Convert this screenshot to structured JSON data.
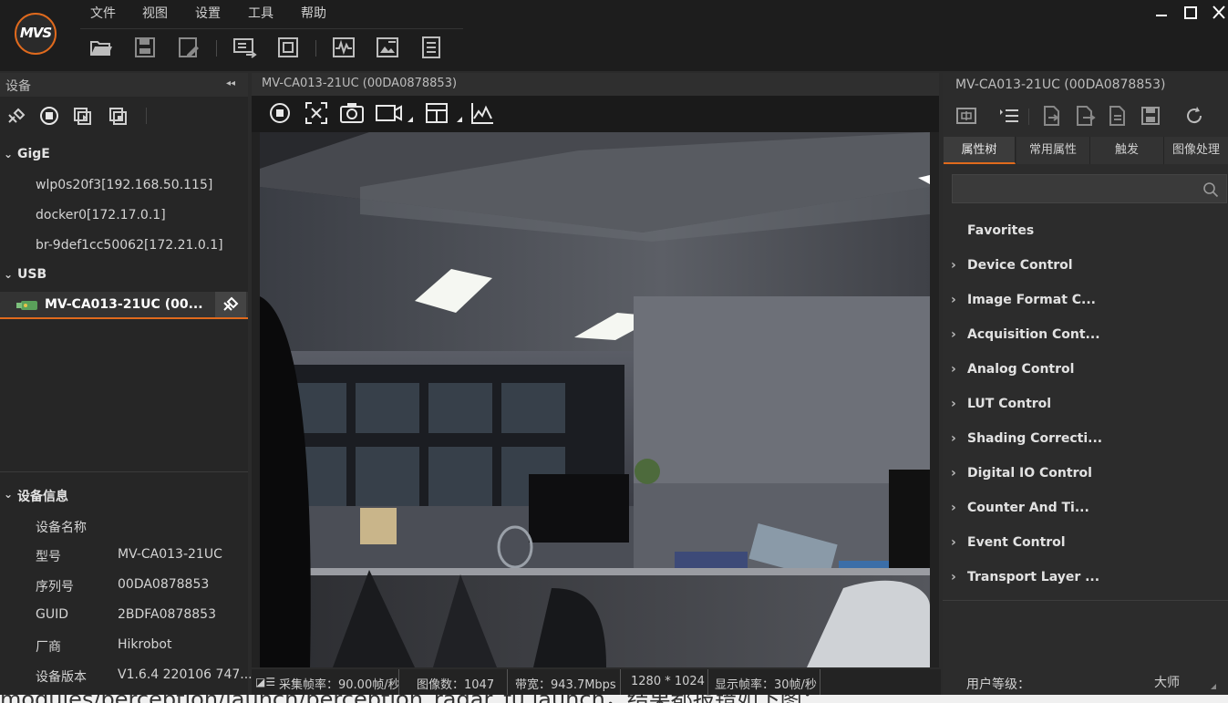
{
  "app": {
    "logo_text": "MVS"
  },
  "menu": [
    "文件",
    "视图",
    "设置",
    "工具",
    "帮助"
  ],
  "toolbar_icons": [
    "open-file-icon",
    "save-icon",
    "save-as-icon",
    "switch-layout-icon",
    "fullscreen-icon",
    "waveform-icon",
    "image-edit-icon",
    "log-icon"
  ],
  "window_controls": [
    "minimize-icon",
    "maximize-icon",
    "close-icon"
  ],
  "left_panel": {
    "title": "设备",
    "collapse": "◂◂",
    "groups": [
      {
        "label": "GigE",
        "items": [
          "wlp0s20f3[192.168.50.115]",
          "docker0[172.17.0.1]",
          "br-9def1cc50062[172.21.0.1]"
        ]
      },
      {
        "label": "USB"
      }
    ],
    "usb_device": "MV-CA013-21UC (00...",
    "device_info": {
      "title": "设备信息",
      "rows": [
        {
          "key": "设备名称",
          "value": ""
        },
        {
          "key": "型号",
          "value": "MV-CA013-21UC"
        },
        {
          "key": "序列号",
          "value": "00DA0878853"
        },
        {
          "key": "GUID",
          "value": "2BDFA0878853"
        },
        {
          "key": "厂商",
          "value": "Hikrobot"
        },
        {
          "key": "设备版本",
          "value": "V1.6.4 220106 747..."
        }
      ]
    }
  },
  "center": {
    "title": "MV-CA013-21UC (00DA0878853)",
    "status": {
      "fps": "采集帧率：90.00帧/秒",
      "frames": "图像数：1047",
      "bandwidth": "带宽：943.7Mbps",
      "resolution": "1280 * 1024",
      "display_fps": "显示帧率：30帧/秒"
    }
  },
  "right_panel": {
    "title": "MV-CA013-21UC (00DA0878853)",
    "tabs": [
      "属性树",
      "常用属性",
      "触发",
      "图像处理"
    ],
    "search_placeholder": "",
    "favorites": "Favorites",
    "properties": [
      "Device Control",
      "Image Format C...",
      "Acquisition Cont...",
      "Analog Control",
      "LUT Control",
      "Shading Correcti...",
      "Digital IO Control",
      "Counter And Ti...",
      "Event Control",
      "Transport Layer ..."
    ],
    "user_level_label": "用户等级：",
    "user_level_value": "大师"
  },
  "bottom_strip_text": "modules/perception/launch/perception_radar_fu.launch，结果都报错如下图：",
  "colors": {
    "accent": "#e06a1d",
    "bg": "#2b2b2b",
    "panel": "#262626"
  }
}
